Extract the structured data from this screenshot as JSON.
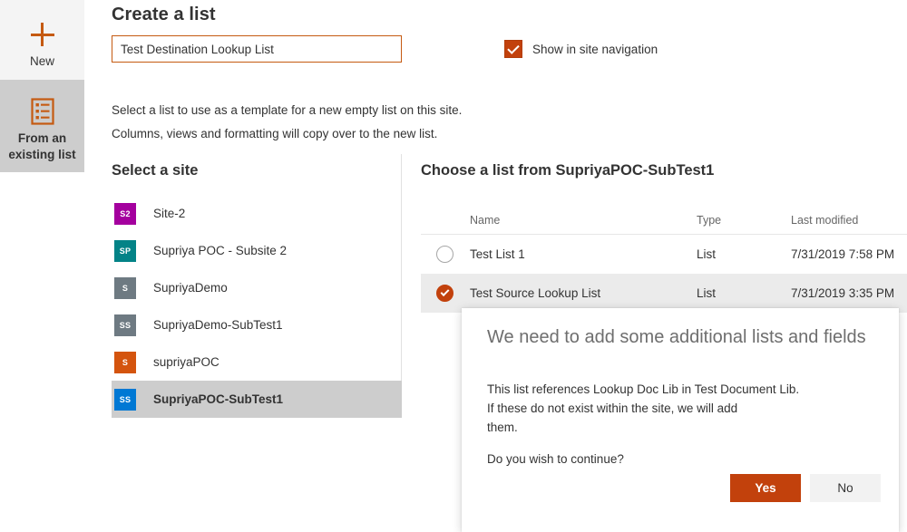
{
  "rail": {
    "items": [
      {
        "label": "New",
        "icon": "plus-icon",
        "selected": false
      },
      {
        "label": "From an\nexisting list",
        "label_line1": "From an",
        "label_line2": "existing list",
        "icon": "list-template-icon",
        "selected": true
      }
    ]
  },
  "header": {
    "title": "Create a list"
  },
  "name_field": {
    "value": "Test Destination Lookup List",
    "placeholder": "Name"
  },
  "show_in_nav": {
    "label": "Show in site navigation",
    "checked": true
  },
  "description": {
    "line1": "Select a list to use as a template for a new empty list on this site.",
    "line2": "Columns, views and formatting will copy over to the new list."
  },
  "sites_panel": {
    "title": "Select a site",
    "items": [
      {
        "initials": "S2",
        "name": "Site-2",
        "color": "#a4009e",
        "selected": false
      },
      {
        "initials": "SP",
        "name": "Supriya POC - Subsite 2",
        "color": "#038387",
        "selected": false
      },
      {
        "initials": "S",
        "name": "SupriyaDemo",
        "color": "#6e7a82",
        "selected": false
      },
      {
        "initials": "SS",
        "name": "SupriyaDemo-SubTest1",
        "color": "#6e7a82",
        "selected": false
      },
      {
        "initials": "S",
        "name": "supriyaPOC",
        "color": "#d4540e",
        "selected": false
      },
      {
        "initials": "SS",
        "name": "SupriyaPOC-SubTest1",
        "color": "#0078d4",
        "selected": true
      }
    ]
  },
  "lists_panel": {
    "title": "Choose a list from SupriyaPOC-SubTest1",
    "columns": [
      "Name",
      "Type",
      "Last modified"
    ],
    "rows": [
      {
        "name": "Test List 1",
        "type": "List",
        "modified": "7/31/2019 7:58 PM",
        "selected": false
      },
      {
        "name": "Test Source Lookup List",
        "type": "List",
        "modified": "7/31/2019 3:35 PM",
        "selected": true
      }
    ]
  },
  "dialog": {
    "title": "We need to add some additional lists and fields",
    "body_line1": "This list references Lookup Doc Lib in Test Document Lib.",
    "body_line2": "If these do not exist within the site, we will add",
    "body_line3": "them.",
    "body_line4": "Do you wish to continue?",
    "confirm_label": "Yes",
    "cancel_label": "No"
  },
  "colors": {
    "accent": "#c2410c",
    "accent_plus": "#c55a11",
    "selected_row": "#ebebeb",
    "selected_site": "#cdcdcd",
    "rail_new_bg": "#f4f4f4"
  }
}
